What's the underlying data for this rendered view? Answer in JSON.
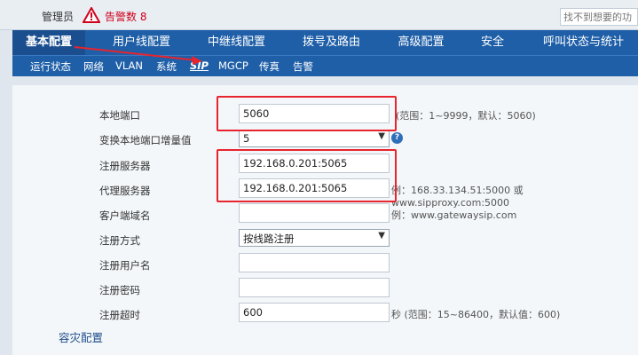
{
  "header": {
    "admin_label": "管理员",
    "alarm_label": "告警数 8",
    "search_placeholder": "找不到想要的功"
  },
  "main_tabs": [
    {
      "label": "基本配置",
      "active": true
    },
    {
      "label": "用户线配置"
    },
    {
      "label": "中继线配置"
    },
    {
      "label": "拨号及路由"
    },
    {
      "label": "高级配置"
    },
    {
      "label": "安全"
    },
    {
      "label": "呼叫状态与统计"
    }
  ],
  "sub_tabs": [
    {
      "label": "运行状态"
    },
    {
      "label": "网络"
    },
    {
      "label": "VLAN"
    },
    {
      "label": "系统"
    },
    {
      "label": "SIP",
      "active": true
    },
    {
      "label": "MGCP"
    },
    {
      "label": "传真"
    },
    {
      "label": "告警"
    }
  ],
  "form": {
    "local_port": {
      "label": "本地端口",
      "value": "5060",
      "hint": "(范围：1~9999，默认：5060)"
    },
    "port_increment": {
      "label": "变换本地端口增量值",
      "value": "5"
    },
    "register_server": {
      "label": "注册服务器",
      "value": "192.168.0.201:5065"
    },
    "proxy_server": {
      "label": "代理服务器",
      "value": "192.168.0.201:5065",
      "hint": "例：168.33.134.51:5000 或 www.sipproxy.com:5000"
    },
    "client_domain": {
      "label": "客户端域名",
      "value": "",
      "hint": "例：www.gatewaysip.com"
    },
    "register_mode": {
      "label": "注册方式",
      "value": "按线路注册"
    },
    "register_username": {
      "label": "注册用户名",
      "value": ""
    },
    "register_password": {
      "label": "注册密码",
      "value": ""
    },
    "register_timeout": {
      "label": "注册超时",
      "value": "600",
      "hint": "秒 (范围：15~86400，默认值：600)"
    }
  },
  "section": {
    "disaster_recovery": "容灾配置"
  },
  "colors": {
    "nav_blue": "#1f5fa8",
    "annotation_red": "#e8242e",
    "alarm_red": "#d0021b"
  }
}
